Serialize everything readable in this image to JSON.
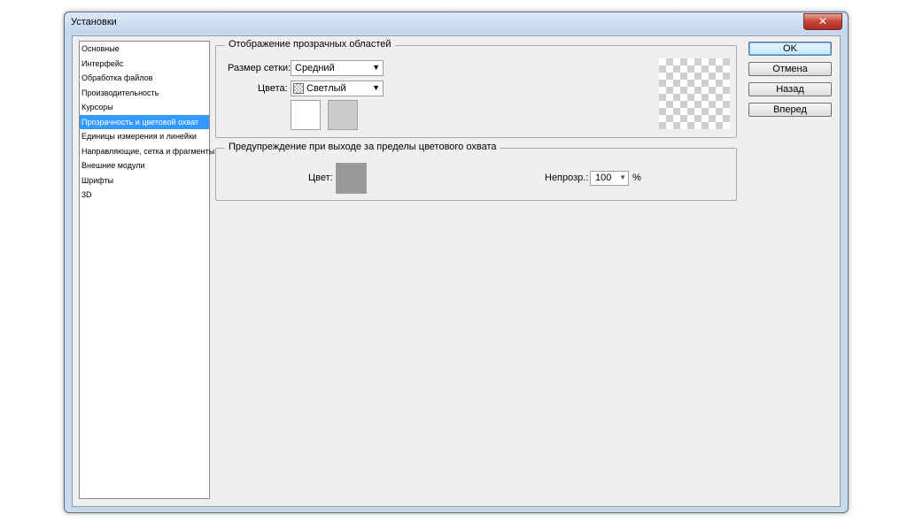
{
  "window": {
    "title": "Установки",
    "close_glyph": "✕"
  },
  "sidebar": {
    "items": [
      {
        "label": "Основные"
      },
      {
        "label": "Интерфейс"
      },
      {
        "label": "Обработка файлов"
      },
      {
        "label": "Производительность"
      },
      {
        "label": "Курсоры"
      },
      {
        "label": "Прозрачность и цветовой охват",
        "selected": true
      },
      {
        "label": "Единицы измерения и линейки"
      },
      {
        "label": "Направляющие, сетка и фрагменты"
      },
      {
        "label": "Внешние модули"
      },
      {
        "label": "Шрифты"
      },
      {
        "label": "3D"
      }
    ]
  },
  "transparency": {
    "legend": "Отображение прозрачных областей",
    "grid_size_label": "Размер сетки:",
    "grid_size_value": "Средний",
    "colors_label": "Цвета:",
    "colors_value": "Светлый",
    "swatch1_color": "#ffffff",
    "swatch2_color": "#cccccc"
  },
  "gamut": {
    "legend": "Предупреждение при выходе за пределы цветового охвата",
    "color_label": "Цвет:",
    "color_value": "#999999",
    "opacity_label": "Непрозр.:",
    "opacity_value": "100",
    "opacity_unit": "%"
  },
  "buttons": {
    "ok": "OK",
    "cancel": "Отмена",
    "back": "Назад",
    "next": "Вперед"
  },
  "icons": {
    "dropdown": "chevron-down-icon",
    "close": "close-icon"
  }
}
